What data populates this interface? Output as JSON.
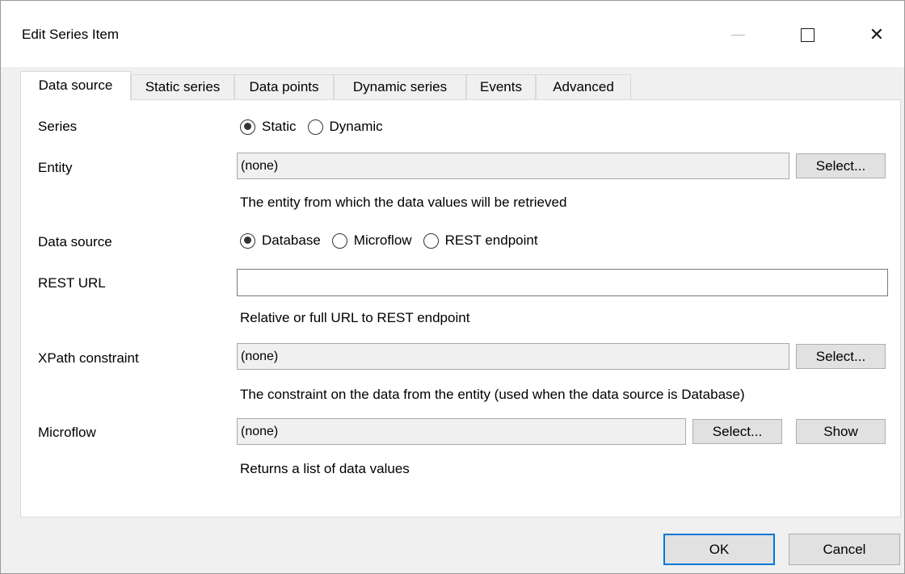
{
  "window": {
    "title": "Edit Series Item",
    "close_glyph": "✕"
  },
  "tabs": [
    {
      "label": "Data source",
      "active": true
    },
    {
      "label": "Static series"
    },
    {
      "label": "Data points"
    },
    {
      "label": "Dynamic series"
    },
    {
      "label": "Events"
    },
    {
      "label": "Advanced"
    }
  ],
  "form": {
    "series": {
      "label": "Series",
      "options": [
        "Static",
        "Dynamic"
      ],
      "selected": "Static"
    },
    "entity": {
      "label": "Entity",
      "value": "(none)",
      "select_label": "Select...",
      "hint": "The entity from which the data values will be retrieved"
    },
    "data_source": {
      "label": "Data source",
      "options": [
        "Database",
        "Microflow",
        "REST endpoint"
      ],
      "selected": "Database"
    },
    "rest_url": {
      "label": "REST URL",
      "value": "",
      "hint": "Relative or full URL to REST endpoint"
    },
    "xpath": {
      "label": "XPath constraint",
      "value": "(none)",
      "select_label": "Select...",
      "hint": "The constraint on the data from the entity (used when the data source is Database)"
    },
    "microflow": {
      "label": "Microflow",
      "value": "(none)",
      "select_label": "Select...",
      "show_label": "Show",
      "hint": "Returns a list of data values"
    }
  },
  "footer": {
    "ok_label": "OK",
    "cancel_label": "Cancel"
  },
  "colors": {
    "default_button_border": "#0078d7",
    "readonly_field_bg": "#f0f0f0"
  }
}
